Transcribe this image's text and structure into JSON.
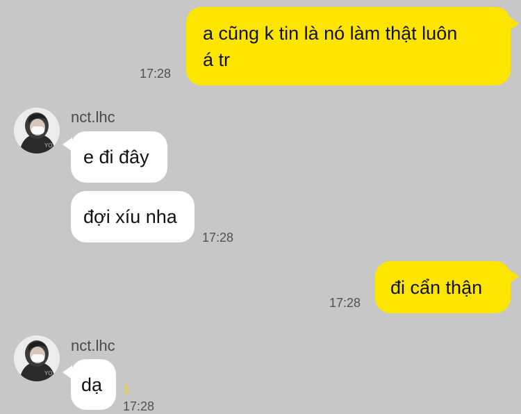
{
  "colors": {
    "background": "#c7c7c7",
    "outgoing_bubble": "#fee500",
    "incoming_bubble": "#ffffff",
    "unread_count": "#f0d400"
  },
  "messages": [
    {
      "direction": "out",
      "lines": [
        "a cũng k tin là nó làm thật luôn",
        "á tr"
      ],
      "time": "17:28"
    },
    {
      "direction": "in",
      "sender": "nct.lhc",
      "avatar": "profile-photo",
      "text": "e đi đây"
    },
    {
      "direction": "in",
      "text": "đợi xíu nha",
      "time": "17:28"
    },
    {
      "direction": "out",
      "text": "đi cẩn thận",
      "time": "17:28"
    },
    {
      "direction": "in",
      "sender": "nct.lhc",
      "avatar": "profile-photo",
      "text": "dạ",
      "unread": "1",
      "time": "17:28"
    }
  ]
}
